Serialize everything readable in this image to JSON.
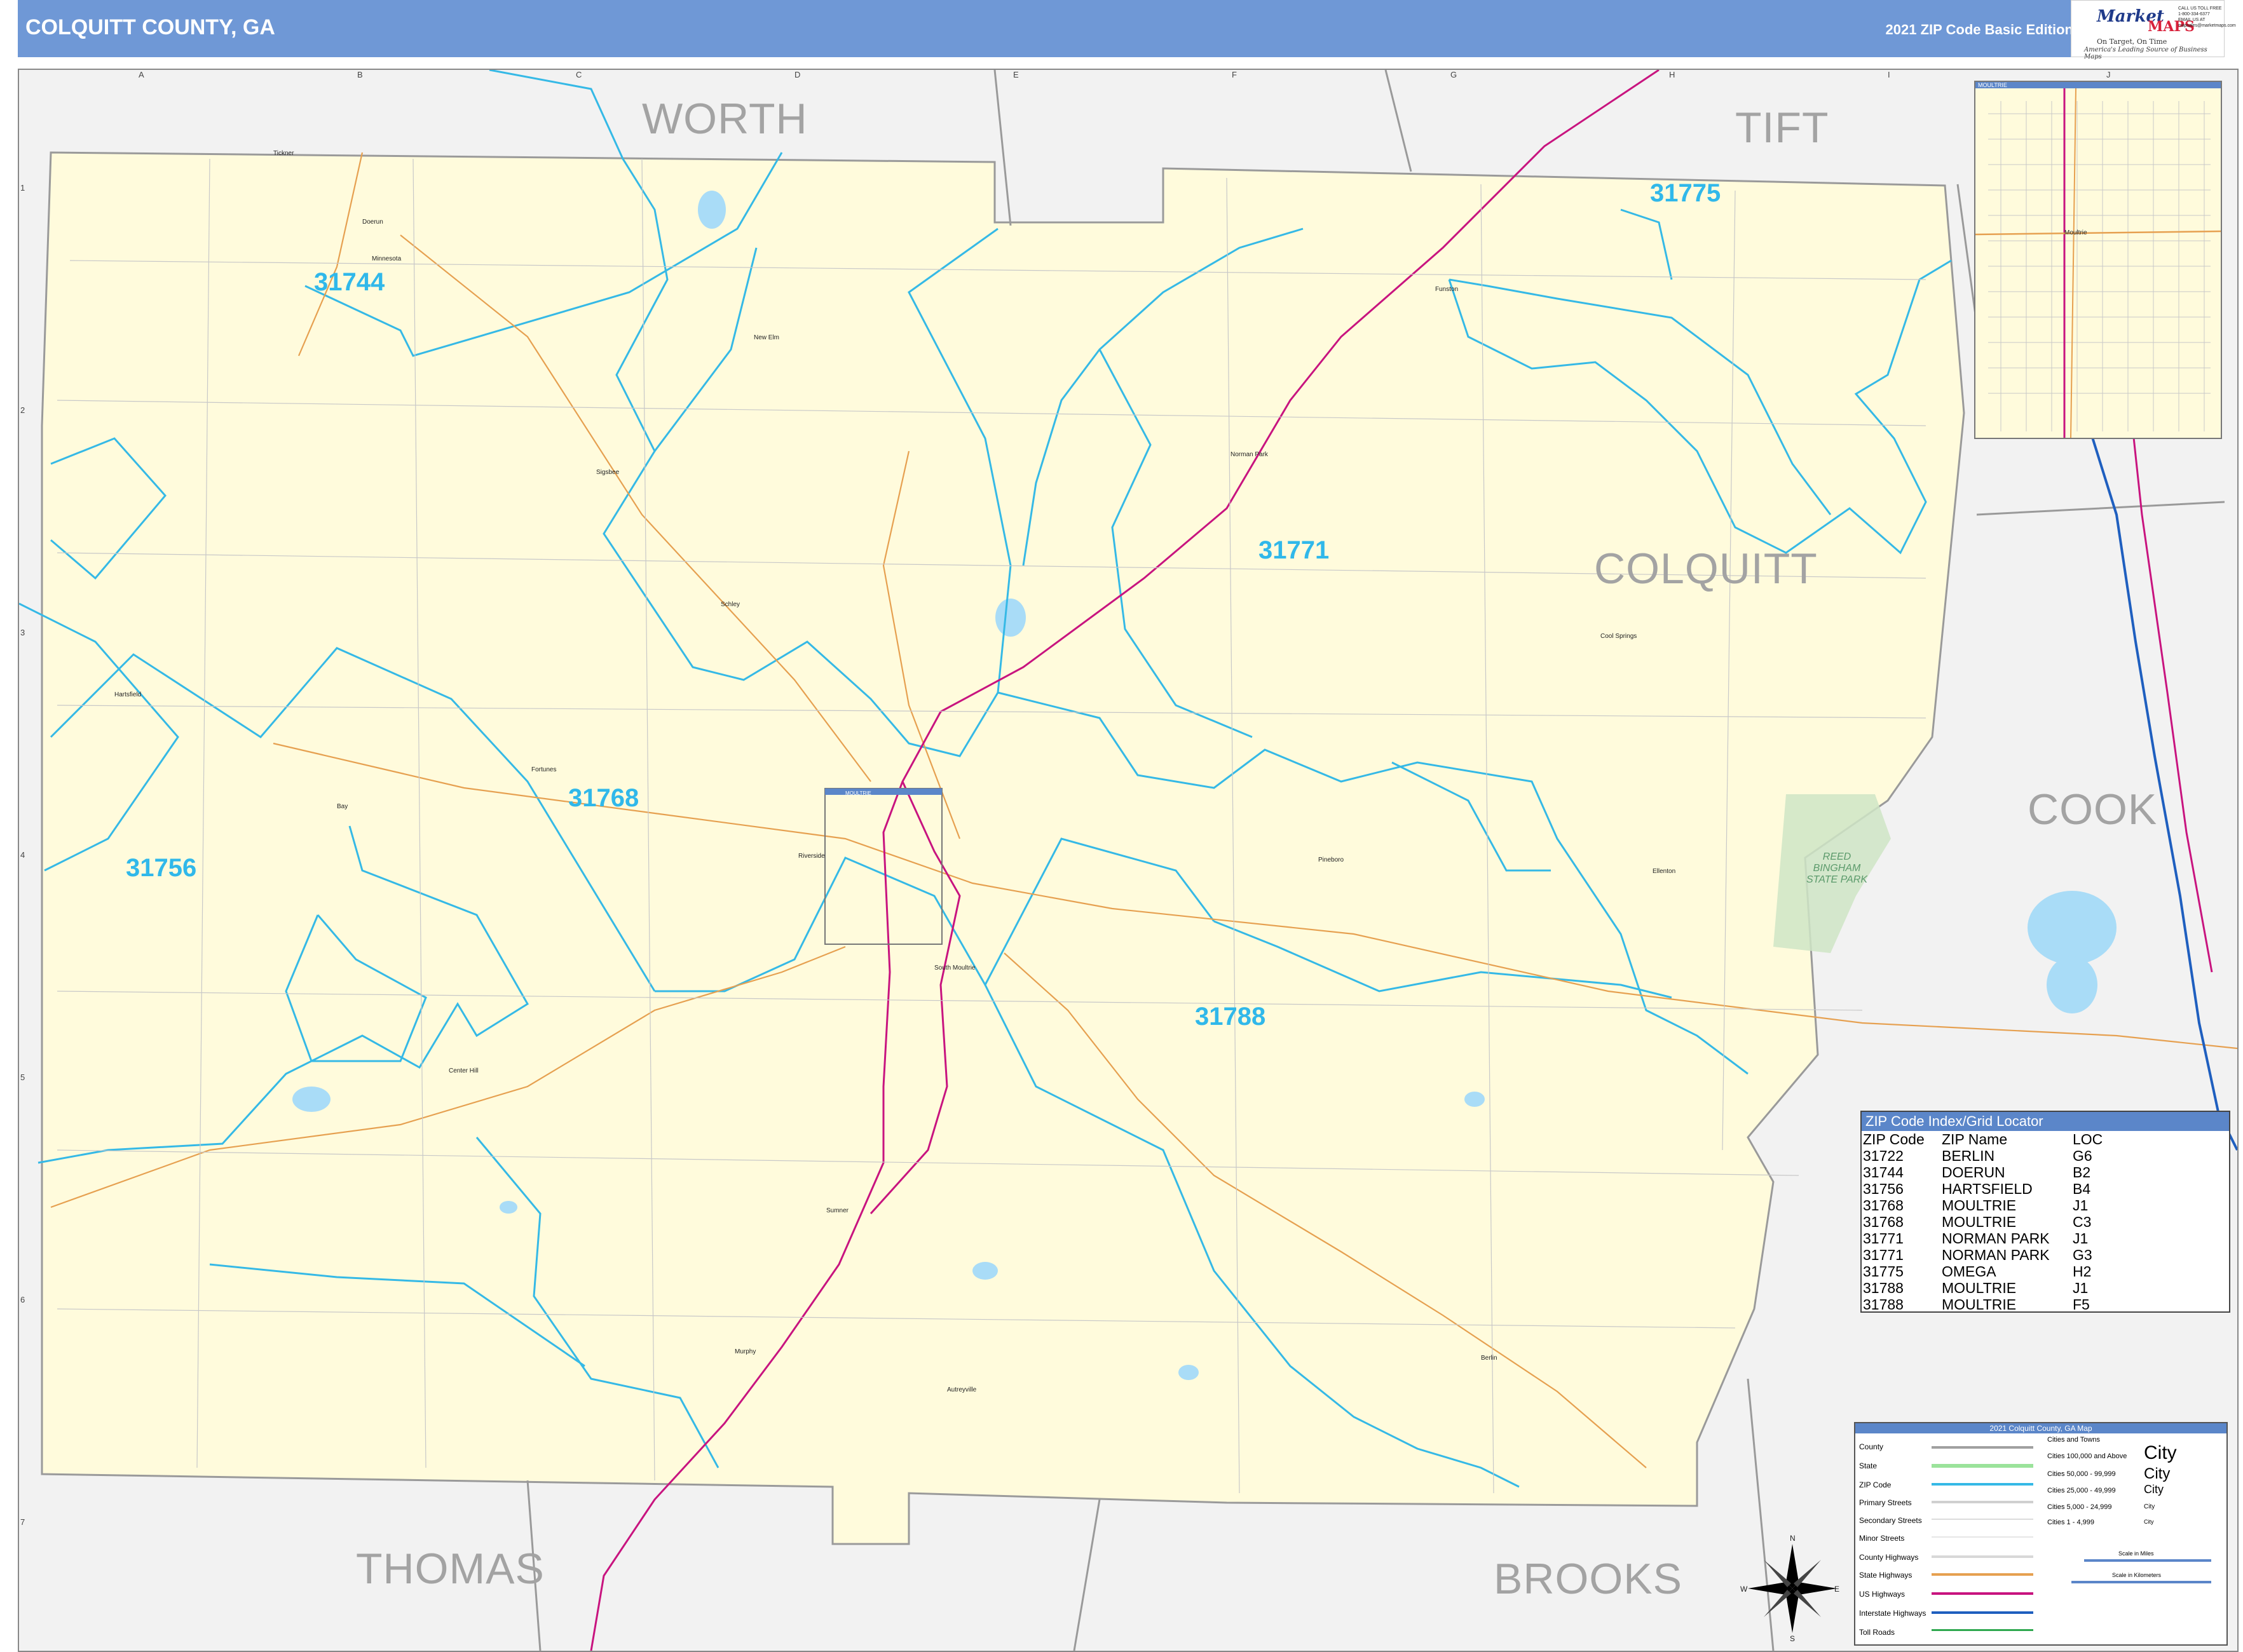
{
  "header": {
    "title": "COLQUITT COUNTY, GA",
    "edition": "2021 ZIP Code Basic Edition"
  },
  "logo": {
    "brand_a": "Market",
    "brand_b": "MAPS",
    "slogan": "On Target, On Time",
    "tagline": "America's Leading Source of Business Maps",
    "contact": "CALL US TOLL FREE 1-800-334-6377 EMAIL US AT mapsales@marketmaps.com"
  },
  "grid": {
    "letters": [
      "A",
      "B",
      "C",
      "D",
      "E",
      "F",
      "G",
      "H",
      "I",
      "J"
    ],
    "numbers": [
      "1",
      "2",
      "3",
      "4",
      "5",
      "6",
      "7"
    ]
  },
  "regions": {
    "worth": "WORTH",
    "tift": "TIFT",
    "colquitt": "COLQUITT",
    "cook": "COOK",
    "thomas": "THOMAS",
    "brooks": "BROOKS"
  },
  "zips": {
    "z31744": "31744",
    "z31775": "31775",
    "z31771": "31771",
    "z31768": "31768",
    "z31756": "31756",
    "z31788": "31788"
  },
  "towns": {
    "doerun": "Doerun",
    "minnesota": "Minnesota",
    "tickner": "Tickner",
    "new_elm": "New Elm",
    "funston": "Funston",
    "norman_park": "Norman Park",
    "sigsbee": "Sigsbee",
    "schley": "Schley",
    "hartsfield": "Hartsfield",
    "cool_springs": "Cool Springs",
    "bay": "Bay",
    "riverside": "Riverside",
    "pineboro": "Pineboro",
    "ellenton": "Ellenton",
    "south_moultrie": "South Moultrie",
    "center_hill": "Center Hill",
    "sumner": "Sumner",
    "murphy": "Murphy",
    "autreyville": "Autreyville",
    "berlin": "Berlin",
    "fortunes": "Fortunes"
  },
  "park": {
    "name": "REED BINGHAM STATE PARK"
  },
  "inset": {
    "label": "MOULTRIE",
    "city": "Moultrie",
    "main_map_label": "MOULTRIE"
  },
  "zip_index": {
    "title": "ZIP Code Index/Grid Locator",
    "columns": [
      "ZIP Code",
      "ZIP Name",
      "LOC"
    ],
    "rows": [
      [
        "31722",
        "BERLIN",
        "G6"
      ],
      [
        "31744",
        "DOERUN",
        "B2"
      ],
      [
        "31756",
        "HARTSFIELD",
        "B4"
      ],
      [
        "31768",
        "MOULTRIE",
        "J1"
      ],
      [
        "31768",
        "MOULTRIE",
        "C3"
      ],
      [
        "31771",
        "NORMAN PARK",
        "J1"
      ],
      [
        "31771",
        "NORMAN PARK",
        "G3"
      ],
      [
        "31775",
        "OMEGA",
        "H2"
      ],
      [
        "31788",
        "MOULTRIE",
        "J1"
      ],
      [
        "31788",
        "MOULTRIE",
        "F5"
      ]
    ]
  },
  "legend": {
    "title": "2021 Colquitt County, GA Map",
    "items": [
      "County",
      "State",
      "ZIP Code",
      "Primary Streets",
      "Secondary Streets",
      "Minor Streets",
      "County Highways",
      "State Highways",
      "US Highways",
      "Interstate Highways",
      "Toll Roads"
    ],
    "cities_header": "Cities and Towns",
    "cities": [
      "Cities 100,000 and Above",
      "Cities 50,000 - 99,999",
      "Cities 25,000 - 49,999",
      "Cities 5,000 - 24,999",
      "Cities 1 - 4,999"
    ],
    "city_word": "City",
    "scale_miles": "Scale in Miles",
    "scale_km": "Scale in Kilometers",
    "compass": [
      "N",
      "S",
      "E",
      "W"
    ]
  },
  "colors": {
    "title_bar": "#6f98d6",
    "county_fill": "#fffbdc",
    "zip_boundary": "#35b9e6",
    "us_highway": "#c8147f",
    "state_highway": "#e6a050",
    "interstate": "#1f5fbf",
    "water": "#a9dcf7",
    "park": "#cfe5c5"
  }
}
